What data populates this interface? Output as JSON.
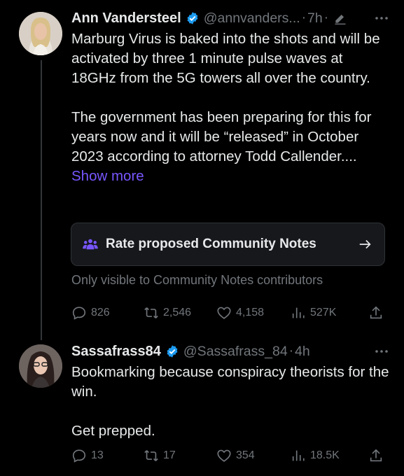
{
  "tweet1": {
    "name": "Ann Vandersteel",
    "handle": "@annvanders...",
    "separator": "·",
    "time": "7h",
    "separator2": "·",
    "text": "Marburg Virus is baked into the shots and will be activated by three 1 minute pulse waves at 18GHz from the 5G towers all over the country.\n\nThe government has been preparing for this for years now and it will be “released” in October 2023 according to attorney Todd Callender....",
    "show_more": "Show more",
    "community_notes": {
      "label": "Rate proposed Community Notes",
      "note": "Only visible to Community Notes contributors"
    },
    "stats": {
      "replies": "826",
      "reposts": "2,546",
      "likes": "4,158",
      "views": "527K"
    }
  },
  "tweet2": {
    "name": "Sassafrass84",
    "handle": "@Sassafrass_84",
    "separator": "·",
    "time": "4h",
    "text": "Bookmarking because conspiracy theorists for the win.\n\nGet prepped.",
    "stats": {
      "replies": "13",
      "reposts": "17",
      "likes": "354",
      "views": "18.5K"
    }
  },
  "colors": {
    "background": "#000000",
    "text": "#e7e9ea",
    "muted": "#71767b",
    "verified": "#1d9bf0",
    "accent": "#7856ff"
  },
  "icons": [
    "verified-badge-icon",
    "edit-icon",
    "more-icon",
    "community-notes-icon",
    "arrow-right-icon",
    "reply-icon",
    "repost-icon",
    "like-icon",
    "views-icon",
    "share-icon"
  ]
}
